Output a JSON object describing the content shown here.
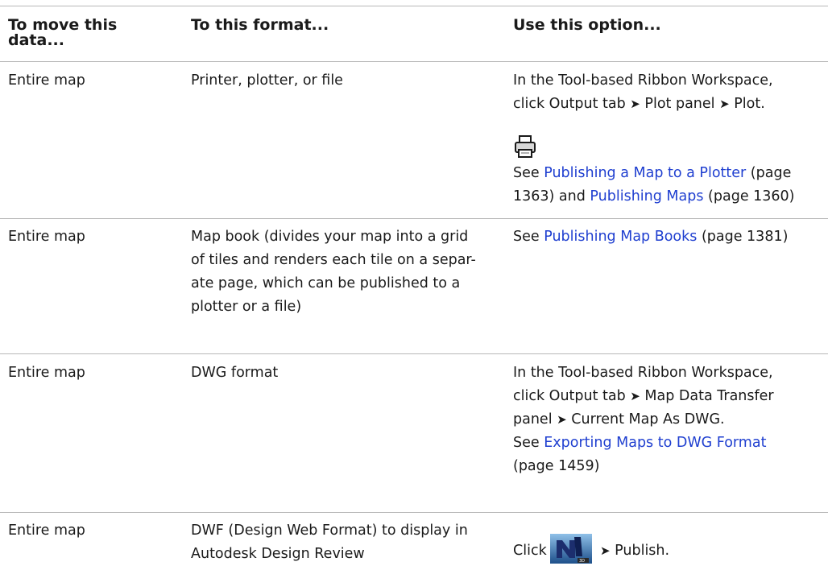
{
  "table": {
    "headers": {
      "data": "To move this data...",
      "data_line1": "To move this",
      "data_line2": "data...",
      "format": "To this format...",
      "option": "Use this option..."
    },
    "rows": [
      {
        "data": "Entire map",
        "format": "Printer, plotter, or file",
        "option_line1": "In the Tool-based Ribbon Workspace,",
        "option_line2_pre": "click Output tab ",
        "option_line2_mid": " Plot panel ",
        "option_line2_post": " Plot.",
        "icon": "printer-icon",
        "see": "See ",
        "link1": "Publishing a Map to a Plotter",
        "page1_a": " (page",
        "page1_b": "1363) and ",
        "link2": "Publishing Maps",
        "page2": " (page 1360)"
      },
      {
        "data": "Entire map",
        "format_lines": [
          "Map book (divides your map into a grid",
          "of tiles and renders each tile on a separ-",
          "ate page, which can be published to a",
          "plotter or a file)"
        ],
        "see": "See ",
        "link1": "Publishing Map Books",
        "page1": " (page 1381)"
      },
      {
        "data": "Entire map",
        "format": "DWG format",
        "option_line1": "In the Tool-based Ribbon Workspace,",
        "option_line2_pre": "click Output tab ",
        "option_line2_post": " Map Data Transfer",
        "option_line3_pre": "panel ",
        "option_line3_post": " Current Map As DWG.",
        "see": "See ",
        "link1": "Exporting Maps to DWG Format",
        "page1": "(page 1459)"
      },
      {
        "data": "Entire map",
        "format_line1": "DWF (Design Web Format) to display in",
        "format_line2": "Autodesk Design Review",
        "option_pre": "Click",
        "icon": "publish-3d-icon",
        "option_post": " Publish."
      }
    ],
    "arrow_glyph": "➤"
  }
}
